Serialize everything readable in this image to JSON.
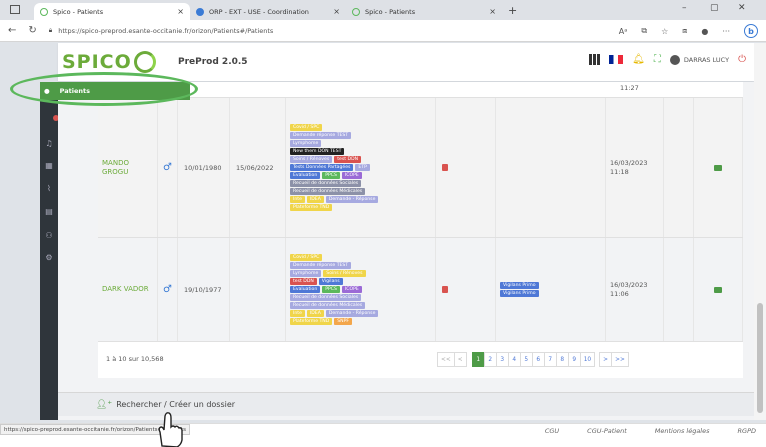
{
  "browser": {
    "tabs": [
      {
        "label": "Spico - Patients",
        "active": true
      },
      {
        "label": "ORP - EXT - USE - Coordination",
        "active": false
      },
      {
        "label": "Spico - Patients",
        "active": false
      }
    ],
    "url": "https://spico-preprod.esante-occitanie.fr/orizon/Patients#/Patients",
    "status_url": "https://spico-preprod.esante-occitanie.fr/orizon/Patients#/Patients"
  },
  "header": {
    "logo": "SPICO",
    "version": "PreProd 2.0.5",
    "user": "DARRAS LUCY"
  },
  "sidebar": {
    "patients_label": "Patients"
  },
  "top_time": "11:27",
  "rows": [
    {
      "name_line1": "MANDO",
      "name_line2": "GROGU",
      "gender": "♂",
      "birth_date": "10/01/1980",
      "entry_date": "15/06/2022",
      "tags": [
        [
          {
            "t": "Covid / SPC",
            "c": "t-yellow"
          }
        ],
        [
          {
            "t": "Demande réponse TEST",
            "c": "t-lilac"
          }
        ],
        [
          {
            "t": "Lymphome",
            "c": "t-lilac"
          }
        ],
        [
          {
            "t": "New them DON TEST",
            "c": "t-black"
          }
        ],
        [
          {
            "t": "Soins / Rénoves",
            "c": "t-lilac"
          },
          {
            "t": "test DDN",
            "c": "t-red"
          }
        ],
        [
          {
            "t": "Tests Données Partagées",
            "c": "t-blue"
          },
          {
            "t": "ETP",
            "c": "t-lilac"
          }
        ],
        [
          {
            "t": "Evaluation",
            "c": "t-blue"
          },
          {
            "t": "PPCS",
            "c": "t-green"
          },
          {
            "t": "ICOPE",
            "c": "t-purple"
          }
        ],
        [
          {
            "t": "Recueil de données Sociales",
            "c": "t-gray"
          }
        ],
        [
          {
            "t": "Recueil de données Médicales",
            "c": "t-gray"
          }
        ],
        [
          {
            "t": "Inte",
            "c": "t-yellow"
          },
          {
            "t": "IDEA",
            "c": "t-yellow"
          },
          {
            "t": "Demande - Réponse",
            "c": "t-lilac"
          }
        ],
        [
          {
            "t": "Plateforme TND",
            "c": "t-yellow"
          }
        ]
      ],
      "alerts": [],
      "modified_date": "16/03/2023",
      "modified_time": "11:18"
    },
    {
      "name_line1": "DARK VADOR",
      "name_line2": "",
      "gender": "♂",
      "birth_date": "19/10/1977",
      "entry_date": "",
      "tags": [
        [
          {
            "t": "Covid / SPC",
            "c": "t-yellow"
          }
        ],
        [
          {
            "t": "Demande réponse TEST",
            "c": "t-lilac"
          }
        ],
        [
          {
            "t": "Lymphome",
            "c": "t-lilac"
          },
          {
            "t": "Soins / Rénoves",
            "c": "t-yellow"
          }
        ],
        [
          {
            "t": "test DDN",
            "c": "t-red"
          },
          {
            "t": "Vigilans",
            "c": "t-blue"
          }
        ],
        [
          {
            "t": "Evaluation",
            "c": "t-blue"
          },
          {
            "t": "PPCS",
            "c": "t-green"
          },
          {
            "t": "ICOPE",
            "c": "t-purple"
          }
        ],
        [
          {
            "t": "Recueil de données Sociales",
            "c": "t-lilac"
          }
        ],
        [
          {
            "t": "Recueil de données Médicales",
            "c": "t-lilac"
          }
        ],
        [
          {
            "t": "Inte",
            "c": "t-yellow"
          },
          {
            "t": "IDEA",
            "c": "t-yellow"
          },
          {
            "t": "Demande - Réponse",
            "c": "t-lilac"
          }
        ],
        [
          {
            "t": "Plateforme TND",
            "c": "t-yellow"
          },
          {
            "t": "SNPF",
            "c": "t-orange"
          }
        ]
      ],
      "alerts": [
        "Vigilans Primo",
        "Vigilans Primo"
      ],
      "modified_date": "16/03/2023",
      "modified_time": "11:06"
    }
  ],
  "table_footer": {
    "count": "1 à 10 sur 10,568",
    "pages": [
      "<<",
      "<",
      "1",
      "2",
      "3",
      "4",
      "5",
      "6",
      "7",
      "8",
      "9",
      "10",
      ">",
      ">>"
    ],
    "active_page": "1"
  },
  "search_bar": {
    "label": "Rechercher / Créer un dossier"
  },
  "footer_links": [
    "CGU",
    "CGU-Patient",
    "Mentions légales",
    "RGPD"
  ],
  "colors": {
    "brand_green": "#4e9b47",
    "logo_green": "#6cab3a",
    "sidebar_dark": "#2f353b"
  }
}
